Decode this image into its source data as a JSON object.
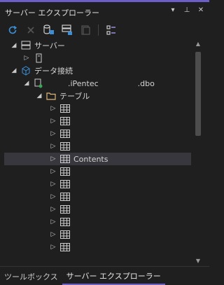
{
  "window": {
    "title": "サーバー エクスプローラー",
    "title_buttons": [
      "▾",
      "⊥",
      "✕"
    ]
  },
  "toolbar": {
    "buttons": [
      {
        "name": "refresh-button",
        "icon": "refresh-icon"
      },
      {
        "name": "stop-button",
        "icon": "stop-icon"
      },
      {
        "name": "connect-database-button",
        "icon": "connect-database-icon"
      },
      {
        "name": "connect-server-button",
        "icon": "connect-server-icon"
      },
      {
        "name": "azure-button",
        "icon": "azure-icon"
      },
      {
        "name": "properties-button",
        "icon": "properties-icon"
      }
    ]
  },
  "tree": {
    "server_root": "サーバー",
    "data_connections": "データ接続",
    "connection_name": ".iPentec",
    "connection_suffix": ".dbo",
    "tables_folder": "テーブル",
    "table_selected": "Contents"
  },
  "tabs": [
    {
      "label": "ツールボックス",
      "active": false
    },
    {
      "label": "サーバー エクスプローラー",
      "active": true
    }
  ],
  "colors": {
    "background": "#1f1f1f",
    "accent": "#6b5fc7",
    "selection": "#37373d",
    "folder": "#dcb67a",
    "icon_blue": "#3b8fd8"
  }
}
